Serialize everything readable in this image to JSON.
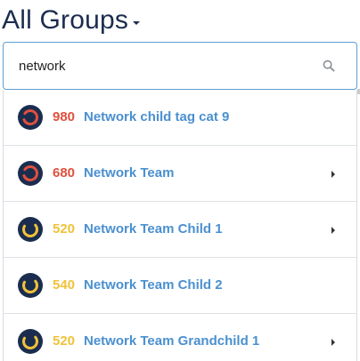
{
  "header": {
    "title": "All Groups"
  },
  "search": {
    "value": "network"
  },
  "colors": {
    "red": "#e0503d",
    "yellow": "#f0c23a",
    "link": "#4a90d0",
    "avatar_bg": "#1b2d4f"
  },
  "results": [
    {
      "score": "980",
      "name": "Network child tag cat 9",
      "status": "red",
      "has_children": false
    },
    {
      "score": "680",
      "name": "Network Team",
      "status": "red",
      "has_children": true
    },
    {
      "score": "520",
      "name": "Network Team Child 1",
      "status": "yellow",
      "has_children": true
    },
    {
      "score": "540",
      "name": "Network Team Child 2",
      "status": "yellow",
      "has_children": false
    },
    {
      "score": "520",
      "name": "Network Team Grandchild 1",
      "status": "yellow",
      "has_children": true
    }
  ]
}
